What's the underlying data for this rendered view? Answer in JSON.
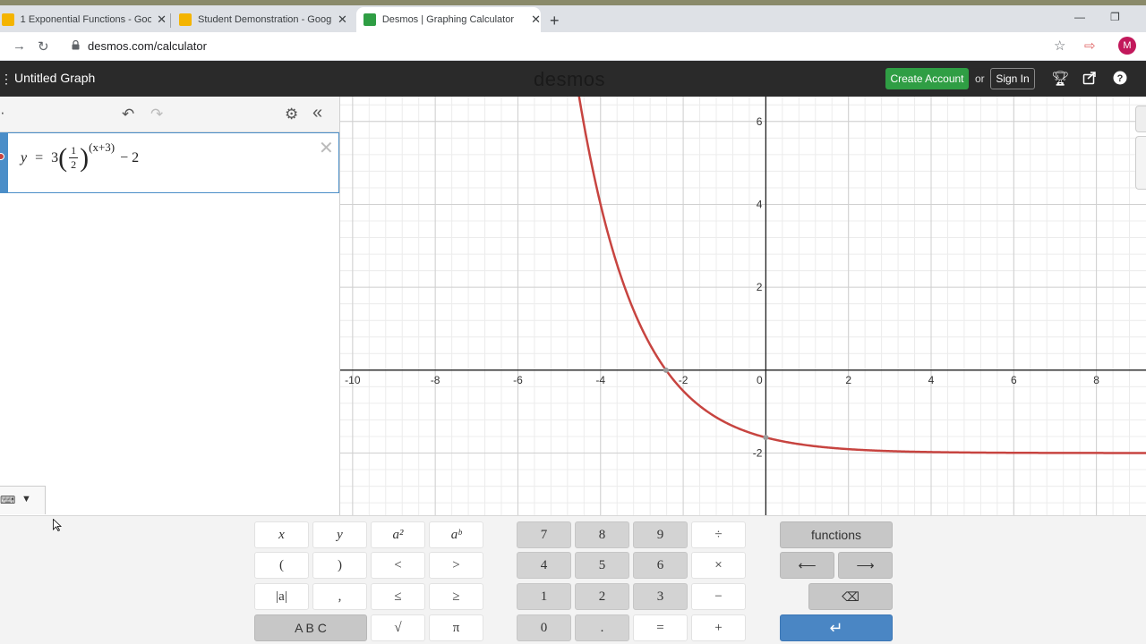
{
  "browser": {
    "tabs": [
      {
        "title": "1 Exponential Functions - Google",
        "favicon_color": "#f4b400",
        "active": false
      },
      {
        "title": "Student Demonstration - Google",
        "favicon_color": "#f4b400",
        "active": false
      },
      {
        "title": "Desmos | Graphing Calculator",
        "favicon_color": "#2f9e44",
        "active": true
      }
    ],
    "url": "desmos.com/calculator",
    "avatar_initial": "M",
    "avatar_color": "#c2185b"
  },
  "desmos_header": {
    "graph_title": "Untitled Graph",
    "logo": "desmos",
    "create_account_label": "Create Account",
    "or_text": "or",
    "sign_in_label": "Sign In",
    "accent_color": "#2f9e44"
  },
  "expression_list": {
    "expressions": [
      {
        "lhs": "y",
        "equals": "=",
        "coefficient": "3",
        "frac_num": "1",
        "frac_den": "2",
        "exponent": "(x+3)",
        "tail": "− 2",
        "color": "#c74440"
      }
    ]
  },
  "graph": {
    "x_ticks": [
      "-10",
      "-8",
      "-6",
      "-4",
      "-2",
      "0",
      "2",
      "4",
      "6",
      "8"
    ],
    "y_ticks": [
      "6",
      "4",
      "2",
      "-2"
    ],
    "x_range": [
      -10.3,
      9.2
    ],
    "y_range": [
      -3.5,
      6.6
    ],
    "curve_color": "#c74440"
  },
  "keypad": {
    "left_keys": [
      "x",
      "y",
      "a²",
      "aᵇ",
      "(",
      ")",
      "<",
      ">",
      "|a|",
      ",",
      "≤",
      "≥",
      "A B C",
      "√",
      "π"
    ],
    "num_keys": [
      "7",
      "8",
      "9",
      "÷",
      "4",
      "5",
      "6",
      "×",
      "1",
      "2",
      "3",
      "−",
      "0",
      ".",
      "=",
      "+"
    ],
    "functions_label": "functions",
    "left_arrow": "⟵",
    "right_arrow": "⟶",
    "backspace": "⌫",
    "enter": "↵"
  }
}
